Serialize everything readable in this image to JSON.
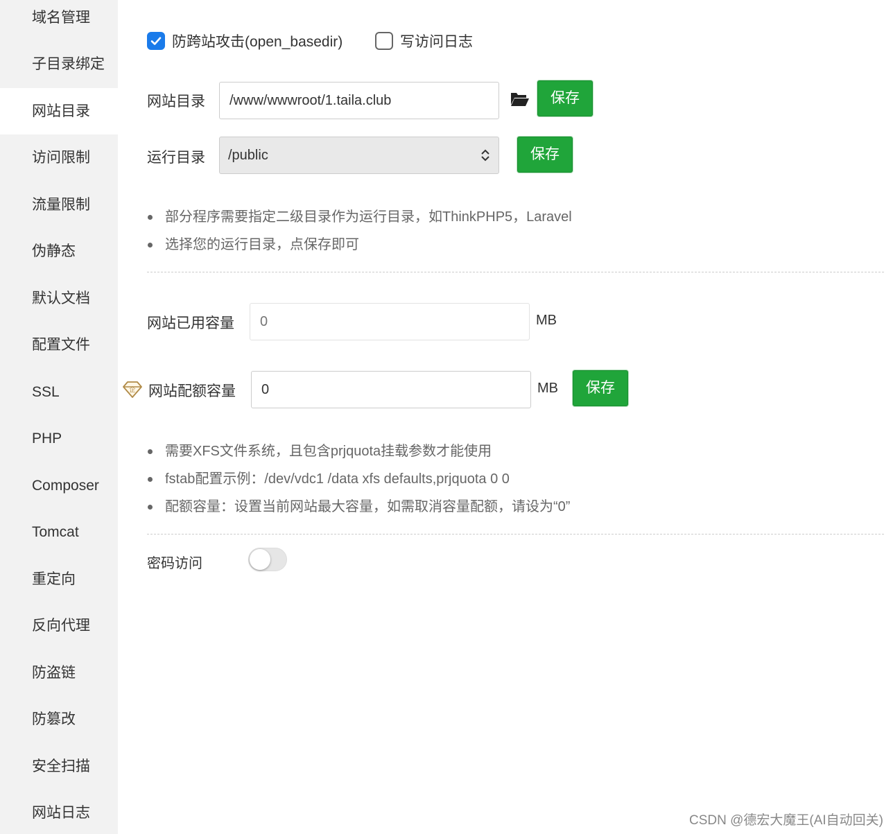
{
  "sidebar": {
    "items": [
      {
        "label": "域名管理"
      },
      {
        "label": "子目录绑定"
      },
      {
        "label": "网站目录",
        "active": true
      },
      {
        "label": "访问限制"
      },
      {
        "label": "流量限制"
      },
      {
        "label": "伪静态"
      },
      {
        "label": "默认文档"
      },
      {
        "label": "配置文件"
      },
      {
        "label": "SSL"
      },
      {
        "label": "PHP"
      },
      {
        "label": "Composer"
      },
      {
        "label": "Tomcat"
      },
      {
        "label": "重定向"
      },
      {
        "label": "反向代理"
      },
      {
        "label": "防盗链"
      },
      {
        "label": "防篡改"
      },
      {
        "label": "安全扫描"
      },
      {
        "label": "网站日志"
      }
    ]
  },
  "options": {
    "anti_xss": {
      "label": "防跨站攻击(open_basedir)",
      "checked": true
    },
    "access_log": {
      "label": "写访问日志",
      "checked": false
    }
  },
  "site_dir": {
    "label": "网站目录",
    "value": "/www/wwwroot/1.taila.club",
    "save_label": "保存",
    "icon": "folder-open-icon"
  },
  "run_dir": {
    "label": "运行目录",
    "selected": "/public",
    "save_label": "保存"
  },
  "dir_tips": [
    "部分程序需要指定二级目录作为运行目录，如ThinkPHP5，Laravel",
    "选择您的运行目录，点保存即可"
  ],
  "quota": {
    "used_label": "网站已用容量",
    "used_placeholder": "0",
    "unit": "MB",
    "limit_label": "网站配额容量",
    "limit_value": "0",
    "save_label": "保存",
    "badge_icon": "enterprise-gem-icon"
  },
  "quota_tips": [
    "需要XFS文件系统，且包含prjquota挂载参数才能使用",
    "fstab配置示例：/dev/vdc1 /data xfs defaults,prjquota 0 0",
    "配额容量：设置当前网站最大容量，如需取消容量配额，请设为“0”"
  ],
  "password_access": {
    "label": "密码访问",
    "enabled": false
  },
  "watermark": "CSDN @德宏大魔王(AI自动回关)",
  "colors": {
    "primary": "#20a53a",
    "checkbox": "#1a7bea",
    "sidebar_bg": "#f2f2f2"
  }
}
